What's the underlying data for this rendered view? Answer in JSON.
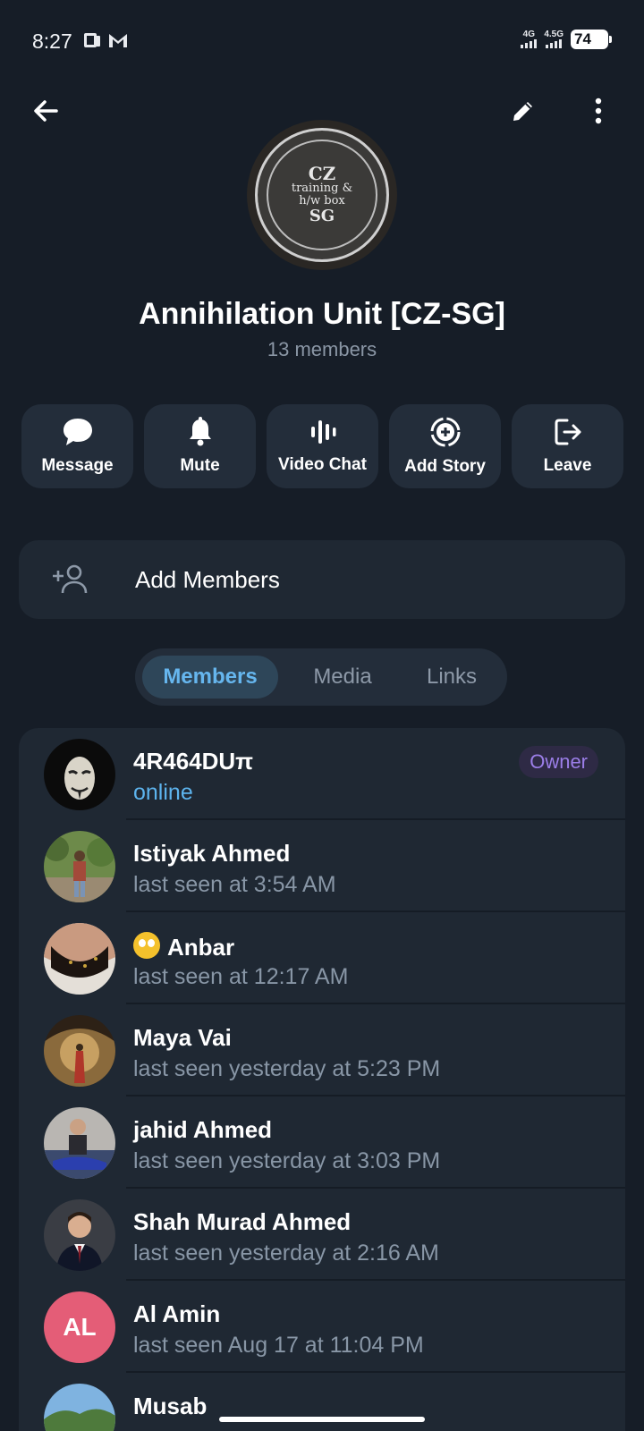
{
  "status_bar": {
    "time": "8:27",
    "network1": "4G",
    "network2": "4.5G",
    "battery": "74"
  },
  "group": {
    "title": "Annihilation Unit [CZ-SG]",
    "members_count": "13 members",
    "avatar_text": {
      "top": "CZ",
      "middle1": "training &",
      "middle2": "h/w box",
      "bottom": "SG"
    }
  },
  "actions": [
    {
      "label": "Message",
      "icon": "message-icon"
    },
    {
      "label": "Mute",
      "icon": "bell-icon"
    },
    {
      "label": "Video Chat",
      "icon": "voice-chat-icon"
    },
    {
      "label": "Add Story",
      "icon": "add-story-icon"
    },
    {
      "label": "Leave",
      "icon": "leave-icon"
    }
  ],
  "add_members": {
    "label": "Add Members"
  },
  "tabs": [
    {
      "label": "Members",
      "active": true
    },
    {
      "label": "Media",
      "active": false
    },
    {
      "label": "Links",
      "active": false
    }
  ],
  "members": [
    {
      "name": "4R464DUπ",
      "status": "online",
      "badge": "Owner"
    },
    {
      "name": "Istiyak Ahmed",
      "status": "last seen at 3:54 AM"
    },
    {
      "name": "Anbar",
      "status": "last seen at 12:17 AM"
    },
    {
      "name": "Maya Vai",
      "status": "last seen yesterday at 5:23 PM"
    },
    {
      "name": "jahid Ahmed",
      "status": "last seen yesterday at 3:03 PM"
    },
    {
      "name": "Shah Murad Ahmed",
      "status": "last seen yesterday at 2:16 AM"
    },
    {
      "name": "Al Amin",
      "status": "last seen Aug 17 at 11:04 PM",
      "initials": "AL"
    },
    {
      "name": "Musab",
      "status": ""
    }
  ],
  "colors": {
    "background": "#161d27",
    "card": "#1f2833",
    "accent": "#5db4ee",
    "owner_badge": "#9b7ee8",
    "initials_avatar": "#e45d77"
  }
}
